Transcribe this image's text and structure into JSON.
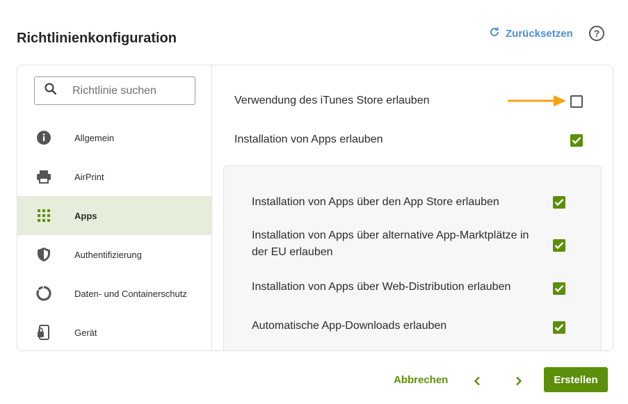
{
  "header": {
    "title": "Richtlinienkonfiguration",
    "reset_label": "Zurücksetzen",
    "help_label": "?"
  },
  "sidebar": {
    "search_placeholder": "Richtlinie suchen",
    "items": [
      {
        "label": "Allgemein",
        "icon": "info-icon",
        "active": false
      },
      {
        "label": "AirPrint",
        "icon": "printer-icon",
        "active": false
      },
      {
        "label": "Apps",
        "icon": "apps-grid-icon",
        "active": true
      },
      {
        "label": "Authentifizierung",
        "icon": "shield-icon",
        "active": false
      },
      {
        "label": "Daten- und Containerschutz",
        "icon": "ring-icon",
        "active": false
      },
      {
        "label": "Gerät",
        "icon": "device-lock-icon",
        "active": false
      }
    ]
  },
  "settings": {
    "itunes": {
      "label": "Verwendung des iTunes Store erlauben",
      "checked": false
    },
    "install_apps": {
      "label": "Installation von Apps erlauben",
      "checked": true
    },
    "sub": [
      {
        "label": "Installation von Apps über den App Store erlauben",
        "checked": true
      },
      {
        "label": "Installation von Apps über alternative App-Marktplätze in der EU erlauben",
        "checked": true
      },
      {
        "label": "Installation von Apps über Web-Distribution erlauben",
        "checked": true
      },
      {
        "label": "Automatische App-Downloads erlauben",
        "checked": true
      }
    ]
  },
  "footer": {
    "cancel_label": "Abbrechen",
    "create_label": "Erstellen"
  },
  "colors": {
    "accent_green": "#5c8f0a",
    "active_bg": "#e6eedb",
    "link_blue": "#4a8fd9",
    "arrow_orange": "#f5a214"
  }
}
